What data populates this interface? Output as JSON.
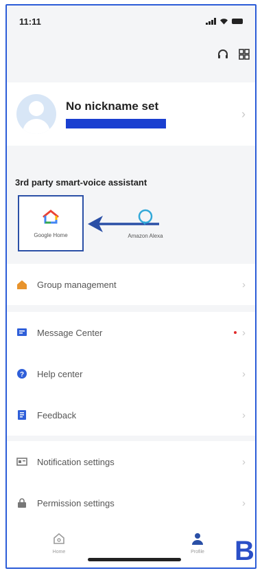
{
  "status_bar": {
    "time": "11:11"
  },
  "profile": {
    "nickname": "No nickname set"
  },
  "voice_section": {
    "title": "3rd party smart-voice assistant",
    "assistants": [
      {
        "label": "Google Home"
      },
      {
        "label": "Amazon Alexa"
      }
    ]
  },
  "menu": {
    "group": [
      {
        "label": "Group management",
        "icon": "house-icon"
      }
    ],
    "support": [
      {
        "label": "Message Center",
        "icon": "message-icon",
        "has_badge": true
      },
      {
        "label": "Help center",
        "icon": "help-icon"
      },
      {
        "label": "Feedback",
        "icon": "feedback-icon"
      }
    ],
    "settings": [
      {
        "label": "Notification settings",
        "icon": "notification-settings-icon"
      },
      {
        "label": "Permission settings",
        "icon": "lock-icon"
      }
    ]
  },
  "tab_bar": {
    "home_label": "Home",
    "profile_label": "Profile"
  },
  "annotation_letter": "B",
  "colors": {
    "accent_blue": "#2a4fa6",
    "highlight_border": "#2a4fa6",
    "redaction": "#1a3fd0",
    "badge_red": "#e02b2b"
  }
}
